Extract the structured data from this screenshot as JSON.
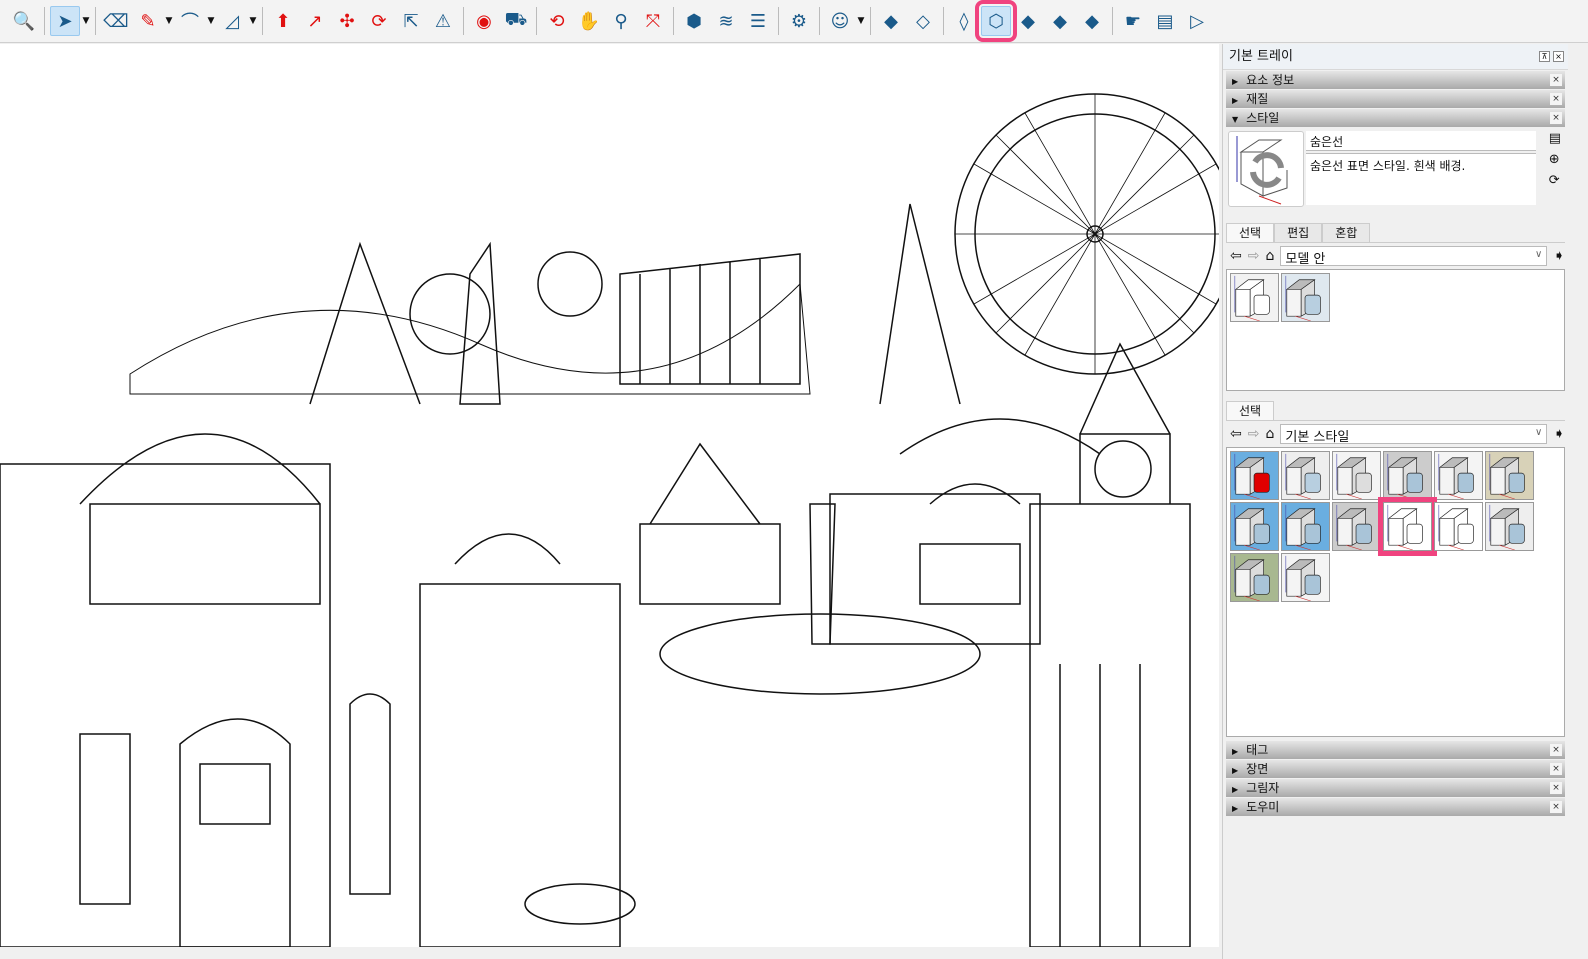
{
  "toolbar": {
    "items": [
      {
        "name": "zoom-icon",
        "g": "🔍"
      },
      {
        "sep": true
      },
      {
        "name": "select-icon",
        "g": "➤",
        "active": true,
        "dd": true
      },
      {
        "sep": true
      },
      {
        "name": "eraser-icon",
        "g": "⌫"
      },
      {
        "name": "pencil-icon",
        "g": "✎",
        "red": true,
        "dd": true
      },
      {
        "name": "arc-icon",
        "g": "⌒",
        "dd": true
      },
      {
        "name": "rectangle-icon",
        "g": "◿",
        "dd": true
      },
      {
        "sep": true
      },
      {
        "name": "push-pull-icon",
        "g": "⬆",
        "red": true
      },
      {
        "name": "follow-me-icon",
        "g": "↗",
        "red": true
      },
      {
        "name": "move-icon",
        "g": "✣",
        "red": true
      },
      {
        "name": "rotate-icon",
        "g": "⟳",
        "red": true
      },
      {
        "name": "scale-icon",
        "g": "⇱"
      },
      {
        "name": "flip-icon",
        "g": "⚠"
      },
      {
        "sep": true
      },
      {
        "name": "tape-measure-icon",
        "g": "◉",
        "red": true
      },
      {
        "name": "paint-bucket-icon",
        "g": "⛟"
      },
      {
        "sep": true
      },
      {
        "name": "orbit-icon",
        "g": "⟲",
        "red": true
      },
      {
        "name": "pan-icon",
        "g": "✋",
        "red": true
      },
      {
        "name": "zoom-tool-icon",
        "g": "⚲"
      },
      {
        "name": "zoom-extents-icon",
        "g": "⤧",
        "red": true
      },
      {
        "sep": true
      },
      {
        "name": "warehouse-icon",
        "g": "⬢"
      },
      {
        "name": "extension-warehouse-icon",
        "g": "≋"
      },
      {
        "name": "layers-icon",
        "g": "☰"
      },
      {
        "sep": true
      },
      {
        "name": "extension-manager-icon",
        "g": "⚙"
      },
      {
        "sep": true
      },
      {
        "name": "account-icon",
        "g": "☺",
        "dd": true
      },
      {
        "sep": true
      },
      {
        "name": "xray-icon",
        "g": "◆"
      },
      {
        "name": "back-edges-icon",
        "g": "◇"
      },
      {
        "sep": true
      },
      {
        "name": "wireframe-icon",
        "g": "◊"
      },
      {
        "name": "hidden-line-icon",
        "g": "⬡",
        "active": true,
        "hl": true
      },
      {
        "name": "shaded-icon",
        "g": "◆"
      },
      {
        "name": "shaded-textures-icon",
        "g": "◆"
      },
      {
        "name": "monochrome-icon",
        "g": "◆"
      },
      {
        "sep": true
      },
      {
        "name": "outliner-icon",
        "g": "☛"
      },
      {
        "name": "entity-info-icon",
        "g": "▤"
      },
      {
        "name": "tray-toggle-icon",
        "g": "▷"
      }
    ]
  },
  "tray": {
    "title": "기본 트레이",
    "panels_top": [
      {
        "label": "요소 정보",
        "open": false
      },
      {
        "label": "재질",
        "open": false
      },
      {
        "label": "스타일",
        "open": true
      }
    ],
    "style": {
      "name": "숨은선",
      "description": "숨은선 표면 스타일. 흰색 배경."
    },
    "tabs": [
      "선택",
      "편집",
      "혼합"
    ],
    "model_select": "모델 안",
    "tab2": "선택",
    "library_select": "기본 스타일",
    "panels_bottom": [
      {
        "label": "태그"
      },
      {
        "label": "장면"
      },
      {
        "label": "그림자"
      },
      {
        "label": "도우미"
      }
    ],
    "close": "×"
  },
  "colors": {
    "highlight": "#f0437f",
    "active": "#cce4f7"
  }
}
